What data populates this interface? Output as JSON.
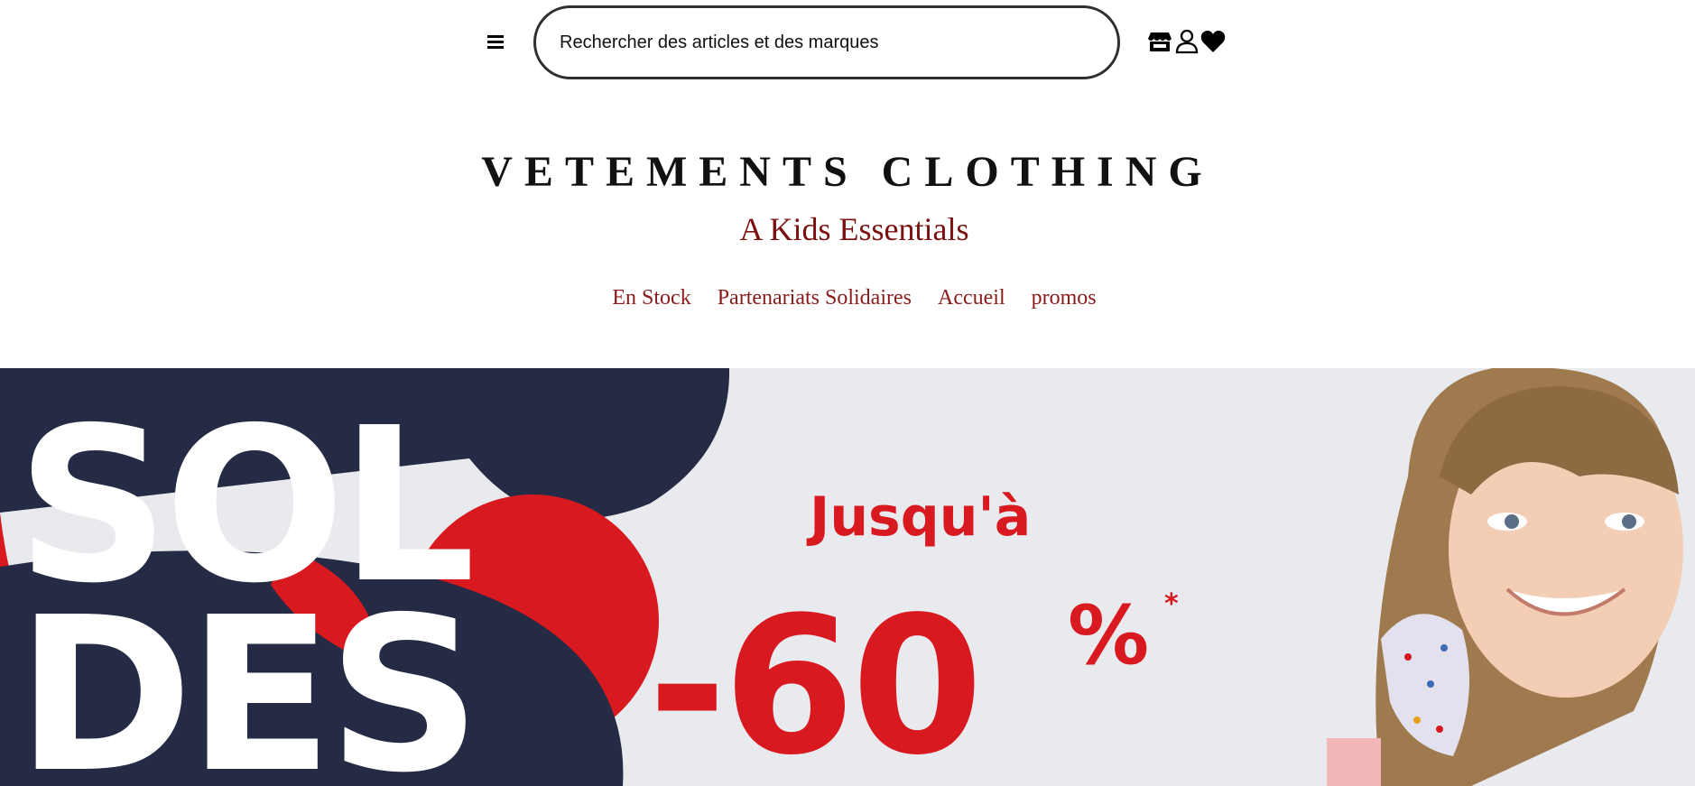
{
  "header": {
    "menu_icon": "hamburger-menu-icon",
    "search": {
      "placeholder": "Rechercher des articles et des marques",
      "value": ""
    },
    "icons": [
      "store-icon",
      "user-icon",
      "heart-icon"
    ]
  },
  "brand": {
    "title": "VETEMENTS CLOTHING",
    "subtitle": "A Kids Essentials"
  },
  "nav": {
    "items": [
      {
        "label": "En Stock"
      },
      {
        "label": "Partenariats Solidaires"
      },
      {
        "label": "Accueil"
      },
      {
        "label": "promos"
      }
    ]
  },
  "hero": {
    "headline": "SOL\nDES",
    "prefix": "Jusqu'à",
    "discount": "-60",
    "percent": "%",
    "asterisk": "*"
  },
  "colors": {
    "brand_subtitle": "#7a1010",
    "nav_link": "#8b1b1b",
    "hero_red": "#d8191f",
    "hero_navy": "#262b45",
    "hero_bg": "#e8eaee"
  }
}
